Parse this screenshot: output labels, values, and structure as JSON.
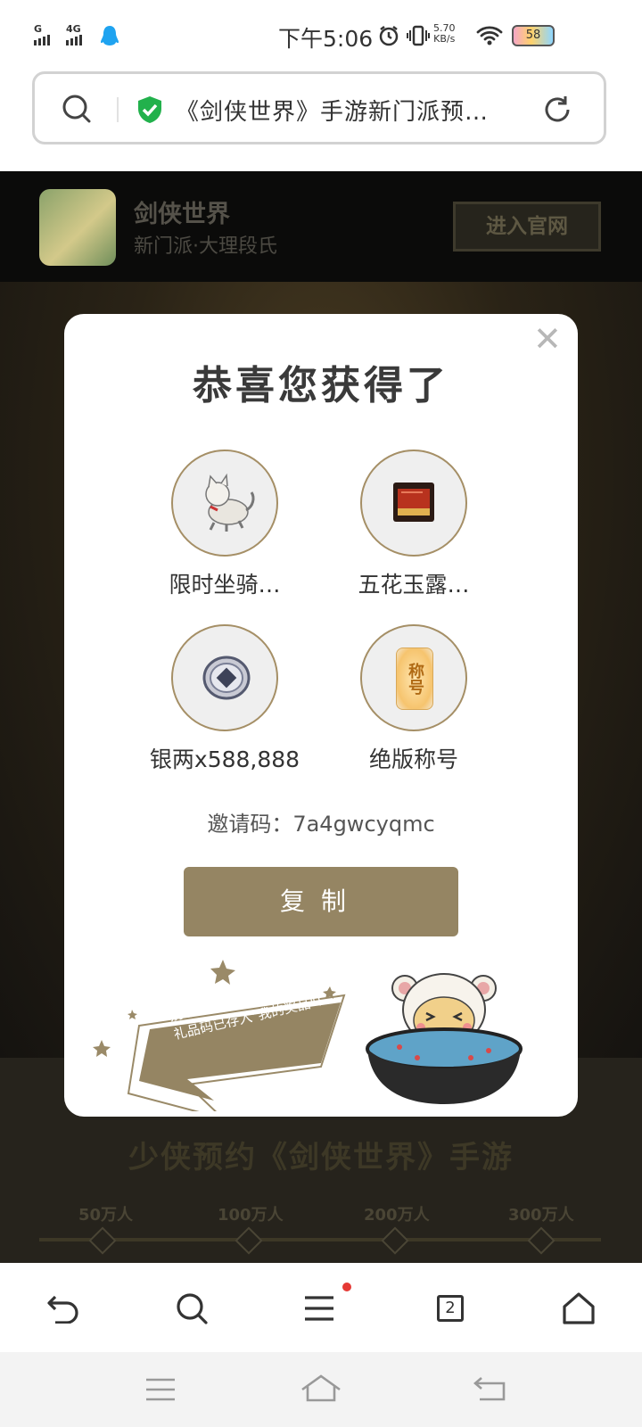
{
  "status_bar": {
    "sim1_label": "G",
    "sim2_label": "4G",
    "time": "下午5:06",
    "net_speed_value": "5.70",
    "net_speed_unit": "KB/s",
    "battery_level": "58"
  },
  "url_bar": {
    "title": "《剑侠世界》手游新门派预…"
  },
  "app_banner": {
    "app_name": "剑侠世界",
    "subtitle": "新门派·大理段氏",
    "enter_button": "进入官网"
  },
  "page": {
    "promo_title": "少侠预约《剑侠世界》手游",
    "milestones": [
      "50万人",
      "100万人",
      "200万人",
      "300万人"
    ]
  },
  "modal": {
    "title": "恭喜您获得了",
    "rewards": [
      {
        "label": "限时坐骑…",
        "icon": "cat-mount-icon"
      },
      {
        "label": "五花玉露…",
        "icon": "red-book-icon"
      },
      {
        "label": "银两x588,888",
        "icon": "silver-coin-icon"
      },
      {
        "label": "绝版称号",
        "icon": "title-badge-icon"
      }
    ],
    "title_badge_text": "称号",
    "invite_label": "邀请码：",
    "invite_code": "7a4gwcyqmc",
    "copy_button": "复制",
    "bubble_line1": "别忘记参与免费抽奖！",
    "bubble_line2": "礼品码已存入\"我的奖品\"！"
  },
  "toolbar": {
    "tab_count": "2"
  },
  "colors": {
    "accent_gold": "#958563",
    "circle_border": "#a58f66",
    "notification_dot": "#e53935"
  }
}
